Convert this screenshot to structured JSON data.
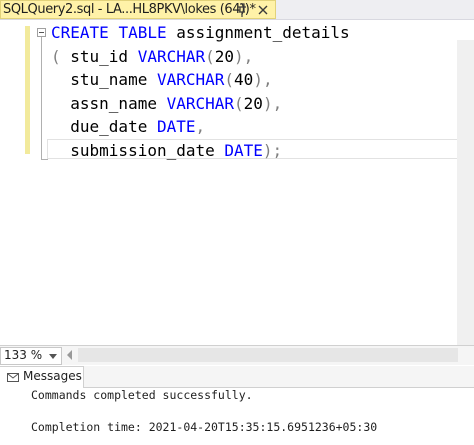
{
  "tab": {
    "title": "SQLQuery2.sql - LA...HL8PKV\\lokes (64))*",
    "pin_icon": "pin-icon",
    "close_icon": "close-icon"
  },
  "editor": {
    "lines": [
      {
        "parts": [
          {
            "t": "CREATE",
            "c": "kw"
          },
          {
            "t": " ",
            "c": "plain"
          },
          {
            "t": "TABLE",
            "c": "kw"
          },
          {
            "t": " assignment_details",
            "c": "plain"
          }
        ]
      },
      {
        "parts": [
          {
            "t": "( ",
            "c": "punct"
          },
          {
            "t": "stu_id ",
            "c": "plain"
          },
          {
            "t": "VARCHAR",
            "c": "kw"
          },
          {
            "t": "(",
            "c": "punct"
          },
          {
            "t": "20",
            "c": "num"
          },
          {
            "t": "),",
            "c": "punct"
          }
        ]
      },
      {
        "parts": [
          {
            "t": "  stu_name ",
            "c": "plain"
          },
          {
            "t": "VARCHAR",
            "c": "kw"
          },
          {
            "t": "(",
            "c": "punct"
          },
          {
            "t": "40",
            "c": "num"
          },
          {
            "t": "),",
            "c": "punct"
          }
        ]
      },
      {
        "parts": [
          {
            "t": "  assn_name ",
            "c": "plain"
          },
          {
            "t": "VARCHAR",
            "c": "kw"
          },
          {
            "t": "(",
            "c": "punct"
          },
          {
            "t": "20",
            "c": "num"
          },
          {
            "t": "),",
            "c": "punct"
          }
        ]
      },
      {
        "parts": [
          {
            "t": "  due_date ",
            "c": "plain"
          },
          {
            "t": "DATE",
            "c": "kw"
          },
          {
            "t": ",",
            "c": "punct"
          }
        ]
      },
      {
        "parts": [
          {
            "t": "  submission_date ",
            "c": "plain"
          },
          {
            "t": "DATE",
            "c": "kw"
          },
          {
            "t": ");",
            "c": "punct"
          }
        ]
      }
    ]
  },
  "zoom": {
    "value": "133 %"
  },
  "results": {
    "tab_label": "Messages",
    "tab_icon": "messages-icon",
    "line1": "Commands completed successfully.",
    "line2": "Completion time: 2021-04-20T15:35:15.6951236+05:30"
  },
  "colors": {
    "keyword": "#0000ff",
    "tab_active": "#fff2a8",
    "change_bar": "#f2ea9c"
  }
}
